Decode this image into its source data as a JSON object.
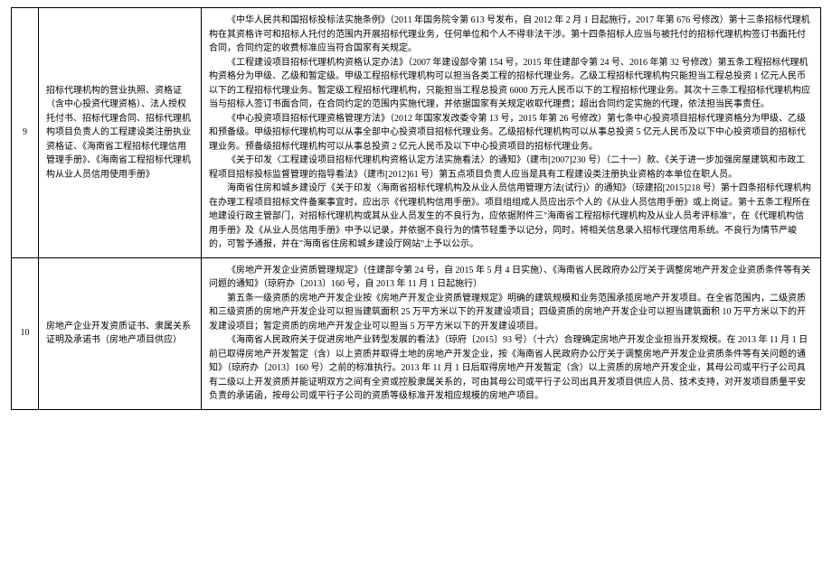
{
  "rows": [
    {
      "seq": "9",
      "title": "招标代理机构的营业执照、资格证（含中心投资代理资格）、法人授权托付书、招标代理合同、招标代理机构项目负责人的工程建设类注册执业资格证、《海南省工程招标代理信用管理手册》、《海南省工程招标代理机构从业人员信用使用手册》",
      "paragraphs": [
        "《中华人民共和国招标投标法实施条例》（2011 年国务院令第 613 号发布，自 2012 年 2 月 1 日起施行，2017 年第 676 号修改）第十三条招标代理机构在其资格许可和招标人托付的范围内开展招标代理业务，任何单位和个人不得非法干涉。第十四条招标人应当与被托付的招标代理机构签订书面托付合同，合同约定的收费标准应当符合国家有关规定。",
        "《工程建设项目招标代理机构资格认定办法》（2007 年建设部令第 154 号，2015 年住建部令第 24 号、2016 年第 32 号修改）第五条工程招标代理机构资格分为甲级、乙级和暂定级。甲级工程招标代理机构可以担当各类工程的招标代理业务。乙级工程招标代理机构只能担当工程总投资 1 亿元人民币以下的工程招标代理业务。暂定级工程招标代理机构，只能担当工程总投资 6000 万元人民币以下的工程招标代理业务。其次十三条工程招标代理机构应当与招标人签订书面合同，在合同约定的范围内实施代理，并依据国家有关规定收取代理费；超出合同约定实施的代理，依法担当民事责任。",
        "《中心投资项目招标代理资格管理方法》（2012 年国家发改委令第 13 号，2015 年第 26 号修改）第七条中心投资项目招标代理资格分为甲级、乙级和预备级。甲级招标代理机构可以从事全部中心投资项目招标代理业务。乙级招标代理机构可以从事总投资 5 亿元人民币及以下中心投资项目的招标代理业务。预备级招标代理机构可以从事总投资 2 亿元人民币及以下中心投资项目的招标代理业务。",
        "《关于印发〈工程建设项目招标代理机构资格认定方法实施看法〉的通知》（建市[2007]230 号）（二十一）款、《关于进一步加强房屋建筑和市政工程项目招标投标监督管理的指导看法》（建市[2012]61 号）第五点项目负责人应当是具有工程建设类注册执业资格的本单位在职人员。",
        "海南省住房和城乡建设厅《关于印发〈海南省招标代理机构及从业人员信用管理方法(试行)〉的通知》（琼建招[2015]218 号）第十四条招标代理机构在办理工程项目招标文件备案事宜时，应出示《代理机构信用手册》。项目组组成人员应出示个人的《从业人员信用手册》或上岗证。第十五条工程所在地建设行政主管部门，对招标代理机构或其从业人员发生的不良行为，应依据附件三\"海南省工程招标代理机构及从业人员考评标准\"，在《代理机构信用手册》及《从业人员信用手册》中予以记录，并依据不良行为的情节轻重予以记分，同时，将相关信息录入招标代理信用系统。不良行为情节严峻的，可暂予通报，并在\"海南省住房和城乡建设厅网站\"上予以公示。"
      ]
    },
    {
      "seq": "10",
      "title": "房地产企业开发资质证书、隶属关系证明及承诺书（房地产项目供应）",
      "paragraphs": [
        "《房地产开发企业资质管理规定》（住建部令第 24 号，自 2015 年 5 月 4 日实施）、《海南省人民政府办公厅关于调整房地产开发企业资质条件等有关问题的通知》（琼府办〔2013〕160 号，自 2013 年 11 月 1 日起施行）",
        "第五条一级资质的房地产开发企业按《房地产开发企业资质管理规定》明确的建筑规模和业务范围承揽房地产开发项目。在全省范围内，二级资质和三级资质的房地产开发企业可以担当建筑面积 25 万平方米以下的开发建设项目；四级资质的房地产开发企业可以担当建筑面积 10 万平方米以下的开发建设项目；暂定资质的房地产开发企业可以担当 5 万平方米以下的开发建设项目。",
        "《海南省人民政府关于促进房地产业转型发展的看法》（琼府〔2015〕93 号）（十六）合理确定房地产开发企业担当开发规模。在 2013 年 11 月 1 日前已取得房地产开发暂定（含）以上资质并取得土地的房地产开发企业，按《海南省人民政府办公厅关于调整房地产开发企业资质条件等有关问题的通知》（琼府办〔2013〕160 号）之前的标准执行。2013 年 11 月 1 日后取得房地产开发暂定（含）以上资质的房地产开发企业，其母公司或平行子公司具有二级以上开发资质并能证明双方之间有全资或控股隶属关系的，可由其母公司或平行子公司出具开发项目供应人员、技术支持，对开发项目质量平安负责的承诺函，按母公司或平行子公司的资质等级标准开发相应规模的房地产项目。"
      ]
    }
  ]
}
